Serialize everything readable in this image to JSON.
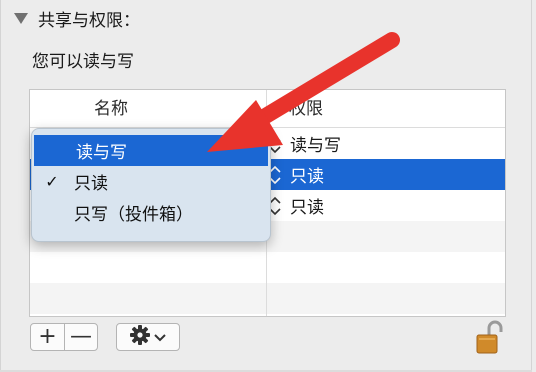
{
  "section": {
    "title": "共享与权限：",
    "permission_text": "您可以读与写"
  },
  "table": {
    "columns": {
      "name": "名称",
      "privilege": "权限"
    },
    "rows": [
      {
        "privilege": "读与写",
        "selected": false
      },
      {
        "privilege": "只读",
        "selected": true
      },
      {
        "privilege": "只读",
        "selected": false
      }
    ]
  },
  "popup_menu": {
    "items": [
      {
        "label": "读与写",
        "highlighted": true,
        "checked": false
      },
      {
        "label": "只读",
        "highlighted": false,
        "checked": true
      },
      {
        "label": "只写（投件箱）",
        "highlighted": false,
        "checked": false
      }
    ],
    "checkmark": "✓"
  },
  "toolbar": {
    "add_label": "+",
    "remove_label": "—",
    "action_icon": "gear-icon",
    "lock_icon": "unlocked-padlock-icon"
  },
  "colors": {
    "selection": "#1b67d3",
    "menu_bg": "#d9e4ef",
    "annotation_arrow": "#e8332c",
    "lock": "#d08a2a"
  }
}
